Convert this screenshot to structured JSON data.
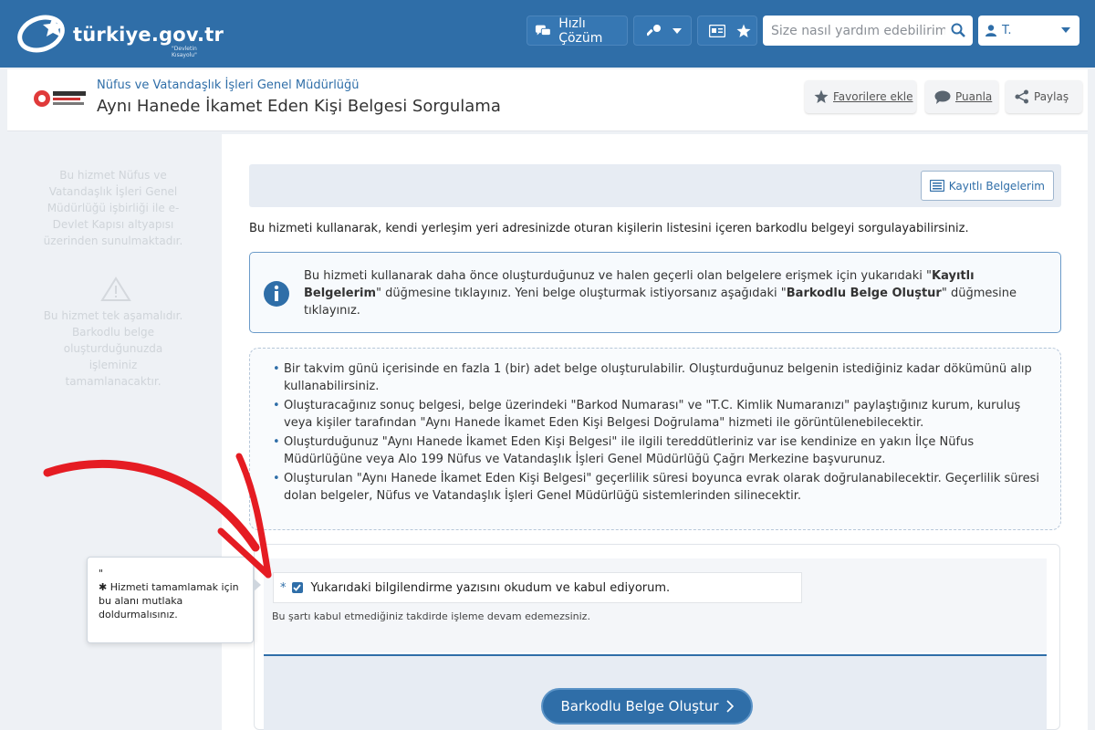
{
  "header": {
    "logo_text": "türkiye.gov.tr",
    "logo_sub": "\"Devletin Kısayolu\"",
    "quick_solution_label": "Hızlı Çözüm",
    "search_placeholder": "Size nasıl yardım edebilirim?",
    "user_label": "T.",
    "colors": {
      "brand": "#2f6ea8"
    }
  },
  "title_bar": {
    "institution": "Nüfus ve Vatandaşlık İşleri Genel Müdürlüğü",
    "page_title": "Aynı Hanede İkamet Eden Kişi Belgesi Sorgulama",
    "favorite_label": "Favorilere ekle",
    "rate_label": "Puanla",
    "share_label": "Paylaş"
  },
  "sidebar": {
    "provider_text": "Bu hizmet Nüfus ve Vatandaşlık İşleri Genel Müdürlüğü işbirliği ile e-Devlet Kapısı altyapısı üzerinden sunulmaktadır.",
    "step_text": "Bu hizmet tek aşamalıdır. Barkodlu belge oluşturduğunuzda işleminiz tamamlanacaktır."
  },
  "main": {
    "saved_docs_label": "Kayıtlı Belgelerim",
    "intro": "Bu hizmeti kullanarak, kendi yerleşim yeri adresinizde oturan kişilerin listesini içeren barkodlu belgeyi sorgulayabilirsiniz.",
    "info": {
      "p1": "Bu hizmeti kullanarak daha önce oluşturduğunuz ve halen geçerli olan belgelere erişmek için yukarıdaki \"",
      "b1": "Kayıtlı Belgelerim",
      "p2": "\" düğmesine tıklayınız. Yeni belge oluşturmak istiyorsanız aşağıdaki \"",
      "b2": "Barkodlu Belge Oluştur",
      "p3": "\" düğmesine tıklayınız."
    },
    "rules": [
      "Bir takvim günü içerisinde en fazla 1 (bir) adet belge oluşturulabilir. Oluşturduğunuz belgenin istediğiniz kadar dökümünü alıp kullanabilirsiniz.",
      "Oluşturacağınız sonuç belgesi, belge üzerindeki \"Barkod Numarası\" ve \"T.C. Kimlik Numaranızı\" paylaştığınız kurum, kuruluş veya kişiler tarafından \"Aynı Hanede İkamet Eden Kişi Belgesi Doğrulama\" hizmeti ile görüntülenebilecektir.",
      "Oluşturduğunuz \"Aynı Hanede İkamet Eden Kişi Belgesi\" ile ilgili tereddütleriniz var ise kendinize en yakın İlçe Nüfus Müdürlüğüne veya Alo 199 Nüfus ve Vatandaşlık İşleri Genel Müdürlüğü Çağrı Merkezine başvurunuz.",
      "Oluşturulan \"Aynı Hanede İkamet Eden Kişi Belgesi\" geçerlilik süresi boyunca evrak olarak doğrulanabilecektir. Geçerlilik süresi dolan belgeler, Nüfus ve Vatandaşlık İşleri Genel Müdürlüğü sistemlerinden silinecektir."
    ],
    "consent": {
      "required_mark": "*",
      "label": "Yukarıdaki bilgilendirme yazısını okudum ve kabul ediyorum.",
      "checked": true,
      "note": "Bu şartı kabul etmediğiniz takdirde işleme devam edemezsiniz."
    },
    "submit_label": "Barkodlu Belge Oluştur"
  },
  "tooltip": {
    "quote": "\"",
    "star": "✱",
    "text": "Hizmeti tamamlamak için bu alanı mutlaka doldurmalısınız."
  }
}
